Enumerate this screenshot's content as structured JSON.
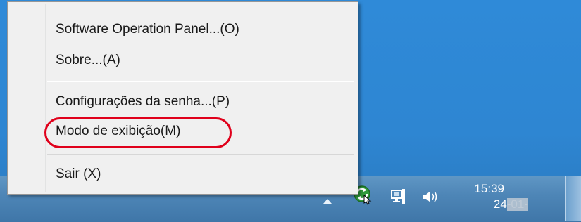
{
  "context_menu": {
    "items": [
      {
        "label": "Software Operation Panel...(O)"
      },
      {
        "label": "Sobre...(A)"
      },
      {
        "label": "Configurações da senha...(P)"
      },
      {
        "label": "Modo de exibição(M)",
        "highlighted": true
      }
    ],
    "exit_label": "Sair (X)",
    "highlight_color": "#e0001b"
  },
  "taskbar": {
    "tray_icons": [
      "show-hidden-icons-arrow",
      "scanner-app-icon",
      "network-icon",
      "volume-icon"
    ],
    "clock": {
      "time": "15:39",
      "date": "24-01-"
    }
  },
  "colors": {
    "desktop": "#2e86d2",
    "taskbar": "#4e86b7",
    "menu_background": "#f0f0f0"
  }
}
